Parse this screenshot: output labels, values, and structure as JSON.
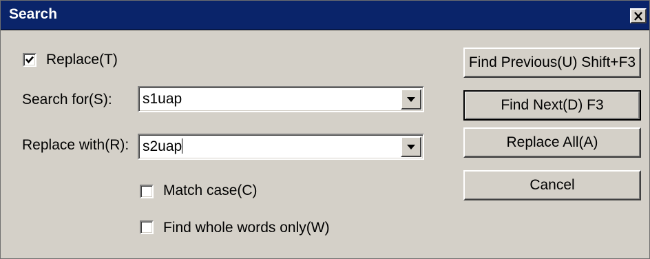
{
  "window": {
    "title": "Search",
    "close_glyph": "✕"
  },
  "replace_checkbox": {
    "label": "Replace(T)",
    "checked": true
  },
  "search_for": {
    "label": "Search for(S):",
    "value": "s1uap"
  },
  "replace_with": {
    "label": "Replace with(R):",
    "value": "s2uap"
  },
  "options": {
    "match_case": {
      "label": "Match case(C)",
      "checked": false
    },
    "whole_words": {
      "label": "Find whole words only(W)",
      "checked": false
    }
  },
  "buttons": {
    "find_previous": "Find Previous(U) Shift+F3",
    "find_next": "Find Next(D) F3",
    "replace_all": "Replace All(A)",
    "cancel": "Cancel"
  },
  "colors": {
    "titlebar": "#0a246a",
    "face": "#d4d0c8"
  }
}
